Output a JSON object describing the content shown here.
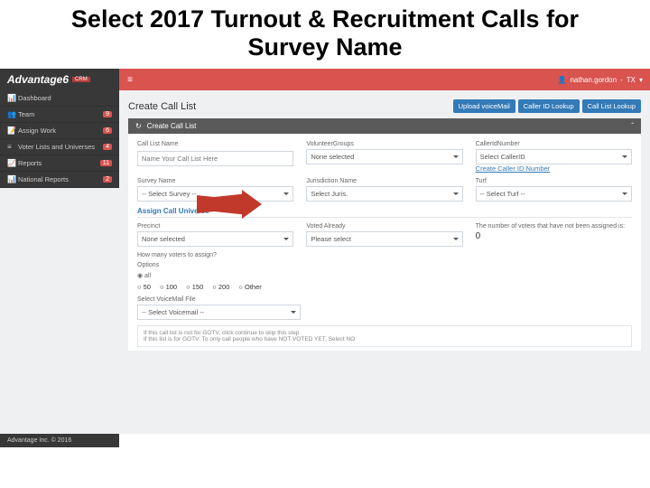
{
  "slide_title": "Select 2017 Turnout & Recruitment Calls for Survey Name",
  "brand": {
    "name": "Advantage",
    "suffix": "6",
    "tag": "CRM"
  },
  "user": {
    "name": "nathan.gordon",
    "region": "TX"
  },
  "sidebar": [
    {
      "icon": "📊",
      "label": "Dashboard",
      "badge": ""
    },
    {
      "icon": "👥",
      "label": "Team",
      "badge": "9"
    },
    {
      "icon": "📝",
      "label": "Assign Work",
      "badge": "6"
    },
    {
      "icon": "≡",
      "label": "Voter Lists and Universes",
      "badge": "4"
    },
    {
      "icon": "📈",
      "label": "Reports",
      "badge": "11"
    },
    {
      "icon": "📊",
      "label": "National Reports",
      "badge": "2"
    }
  ],
  "footer": "Advantage Inc. © 2016",
  "page": {
    "title": "Create Call List",
    "buttons": [
      "Upload voiceMail",
      "Caller ID Lookup",
      "Call List Lookup"
    ]
  },
  "panel": {
    "step_icon": "↻",
    "title": "Create Call List"
  },
  "fields": {
    "name": {
      "label": "Call List Name",
      "placeholder": "Name Your Call List Here"
    },
    "volunteer": {
      "label": "VolunteerGroups",
      "value": "None selected"
    },
    "caller_id": {
      "label": "CallerIdNumber",
      "value": "Select CallerID",
      "link": "Create Caller ID Number"
    },
    "survey": {
      "label": "Survey Name",
      "value": "-- Select Survey --"
    },
    "juris": {
      "label": "Jurisdiction Name",
      "value": "Select Juris."
    },
    "turf": {
      "label": "Turf",
      "value": "-- Select Turf --"
    }
  },
  "assign": {
    "title": "Assign Call Universe",
    "precinct": {
      "label": "Precinct",
      "value": "None selected"
    },
    "voted": {
      "label": "Voted Already",
      "value": "Please select"
    },
    "remaining": {
      "label": "The number of voters that have not been assigned is:",
      "value": "0"
    },
    "how_many": "How many voters to assign?",
    "options_label": "Options",
    "all_toggle": "◉ all",
    "radios": [
      "50",
      "100",
      "150",
      "200",
      "Other"
    ]
  },
  "voicemail": {
    "label": "Select VoiceMail File",
    "value": "-- Select Voicemail --"
  },
  "info": {
    "line1": "If this call list is not for GOTV, click continue to skip this step",
    "line2": "If this list is for GOTV: To only call people who have NOT VOTED YET, Select NO"
  }
}
